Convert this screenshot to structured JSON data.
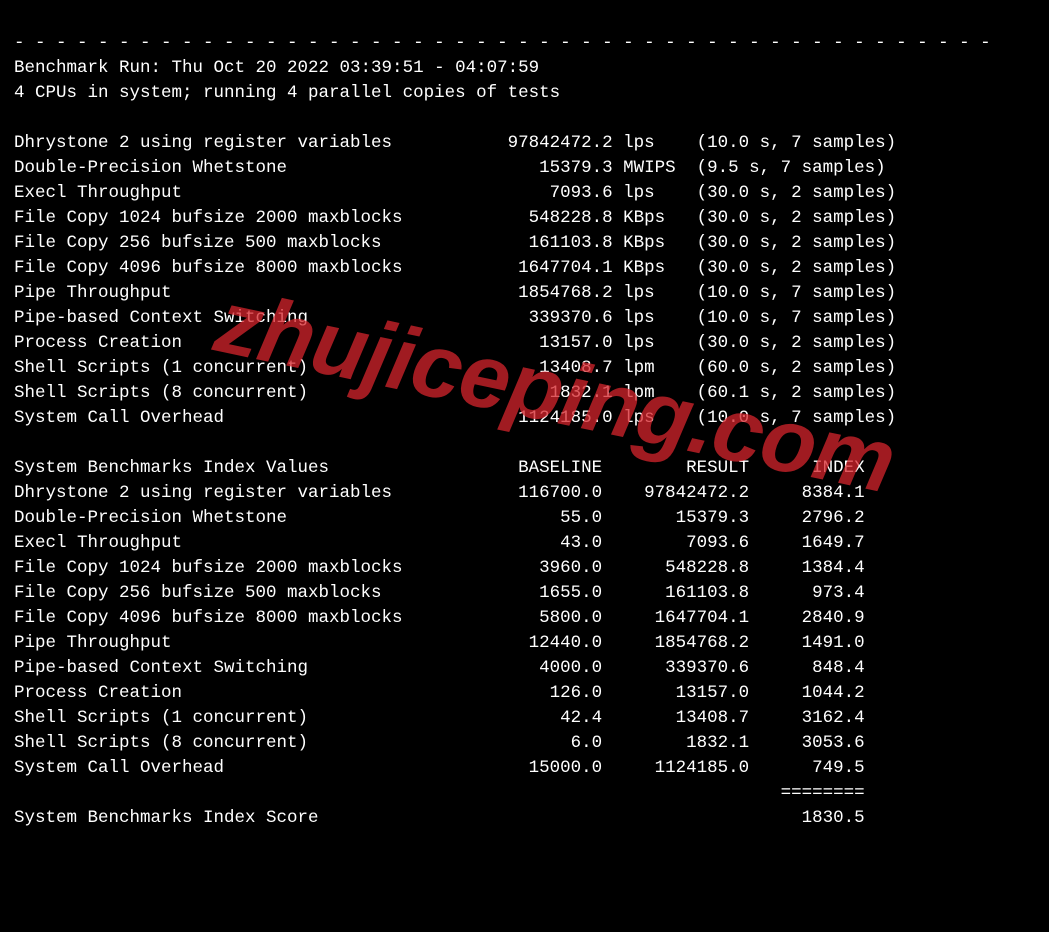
{
  "dashes": "- - - - - - - - - - - - - - - - - - - - - - - - - - - - - - - - - - - - - - - - - - - - - - -",
  "run_line": "Benchmark Run: Thu Oct 20 2022 03:39:51 - 04:07:59",
  "cpu_line": "4 CPUs in system; running 4 parallel copies of tests",
  "tests": [
    {
      "name": "Dhrystone 2 using register variables",
      "value": "97842472.2",
      "unit": "lps",
      "timing": "(10.0 s, 7 samples)"
    },
    {
      "name": "Double-Precision Whetstone",
      "value": "15379.3",
      "unit": "MWIPS",
      "timing": "(9.5 s, 7 samples)"
    },
    {
      "name": "Execl Throughput",
      "value": "7093.6",
      "unit": "lps",
      "timing": "(30.0 s, 2 samples)"
    },
    {
      "name": "File Copy 1024 bufsize 2000 maxblocks",
      "value": "548228.8",
      "unit": "KBps",
      "timing": "(30.0 s, 2 samples)"
    },
    {
      "name": "File Copy 256 bufsize 500 maxblocks",
      "value": "161103.8",
      "unit": "KBps",
      "timing": "(30.0 s, 2 samples)"
    },
    {
      "name": "File Copy 4096 bufsize 8000 maxblocks",
      "value": "1647704.1",
      "unit": "KBps",
      "timing": "(30.0 s, 2 samples)"
    },
    {
      "name": "Pipe Throughput",
      "value": "1854768.2",
      "unit": "lps",
      "timing": "(10.0 s, 7 samples)"
    },
    {
      "name": "Pipe-based Context Switching",
      "value": "339370.6",
      "unit": "lps",
      "timing": "(10.0 s, 7 samples)"
    },
    {
      "name": "Process Creation",
      "value": "13157.0",
      "unit": "lps",
      "timing": "(30.0 s, 2 samples)"
    },
    {
      "name": "Shell Scripts (1 concurrent)",
      "value": "13408.7",
      "unit": "lpm",
      "timing": "(60.0 s, 2 samples)"
    },
    {
      "name": "Shell Scripts (8 concurrent)",
      "value": "1832.1",
      "unit": "lpm",
      "timing": "(60.1 s, 2 samples)"
    },
    {
      "name": "System Call Overhead",
      "value": "1124185.0",
      "unit": "lps",
      "timing": "(10.0 s, 7 samples)"
    }
  ],
  "index_header": {
    "title": "System Benchmarks Index Values",
    "baseline": "BASELINE",
    "result": "RESULT",
    "index": "INDEX"
  },
  "index_rows": [
    {
      "name": "Dhrystone 2 using register variables",
      "baseline": "116700.0",
      "result": "97842472.2",
      "index": "8384.1"
    },
    {
      "name": "Double-Precision Whetstone",
      "baseline": "55.0",
      "result": "15379.3",
      "index": "2796.2"
    },
    {
      "name": "Execl Throughput",
      "baseline": "43.0",
      "result": "7093.6",
      "index": "1649.7"
    },
    {
      "name": "File Copy 1024 bufsize 2000 maxblocks",
      "baseline": "3960.0",
      "result": "548228.8",
      "index": "1384.4"
    },
    {
      "name": "File Copy 256 bufsize 500 maxblocks",
      "baseline": "1655.0",
      "result": "161103.8",
      "index": "973.4"
    },
    {
      "name": "File Copy 4096 bufsize 8000 maxblocks",
      "baseline": "5800.0",
      "result": "1647704.1",
      "index": "2840.9"
    },
    {
      "name": "Pipe Throughput",
      "baseline": "12440.0",
      "result": "1854768.2",
      "index": "1491.0"
    },
    {
      "name": "Pipe-based Context Switching",
      "baseline": "4000.0",
      "result": "339370.6",
      "index": "848.4"
    },
    {
      "name": "Process Creation",
      "baseline": "126.0",
      "result": "13157.0",
      "index": "1044.2"
    },
    {
      "name": "Shell Scripts (1 concurrent)",
      "baseline": "42.4",
      "result": "13408.7",
      "index": "3162.4"
    },
    {
      "name": "Shell Scripts (8 concurrent)",
      "baseline": "6.0",
      "result": "1832.1",
      "index": "3053.6"
    },
    {
      "name": "System Call Overhead",
      "baseline": "15000.0",
      "result": "1124185.0",
      "index": "749.5"
    }
  ],
  "separator": "========",
  "score_label": "System Benchmarks Index Score",
  "score_value": "1830.5",
  "watermark": "zhujiceping.com"
}
